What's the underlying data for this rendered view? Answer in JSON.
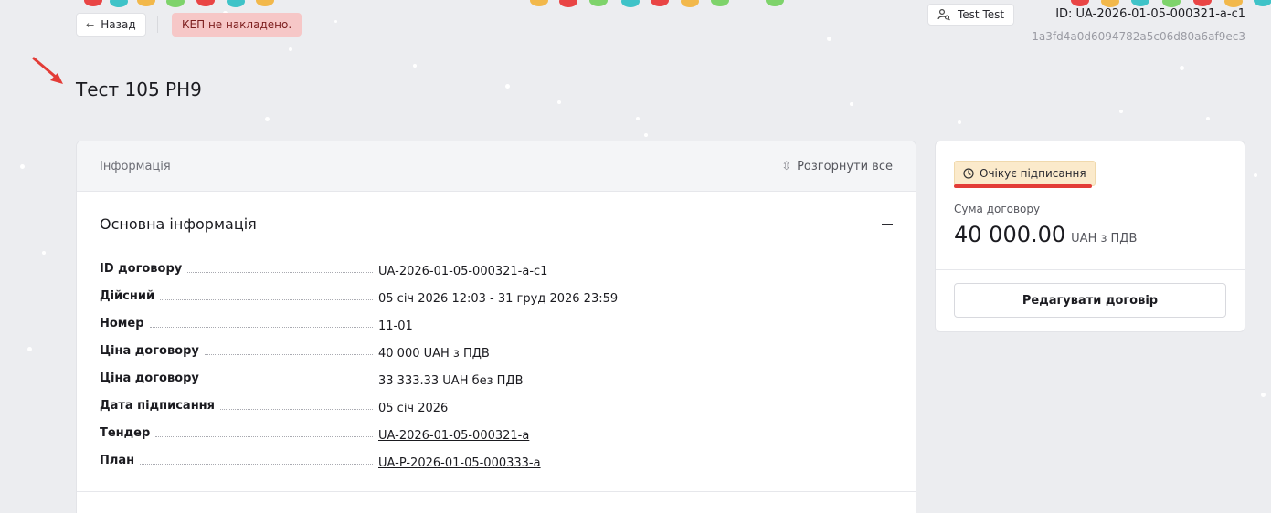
{
  "topbar": {
    "back_label": "Назад",
    "kep_badge": "КЕП не накладено.",
    "user_name": "Test Test",
    "contract_id_header": "ID: UA-2026-01-05-000321-a-c1",
    "hash": "1a3fd4a0d6094782a5c06d80a6af9ec3"
  },
  "page": {
    "title": "Тест 105 РН9"
  },
  "info_card": {
    "header_title": "Інформація",
    "expand_all_label": "Розгорнути все",
    "section_title": "Основна інформація",
    "rows": [
      {
        "label": "ID договору",
        "value": "UA-2026-01-05-000321-a-c1",
        "link": false
      },
      {
        "label": "Дійсний",
        "value": "05 січ 2026 12:03 - 31 груд 2026 23:59",
        "link": false
      },
      {
        "label": "Номер",
        "value": "11-01",
        "link": false
      },
      {
        "label": "Ціна договору",
        "value": "40 000 UAH з ПДВ",
        "link": false
      },
      {
        "label": "Ціна договору",
        "value": "33 333.33 UAH без ПДВ",
        "link": false
      },
      {
        "label": "Дата підписання",
        "value": "05 січ 2026",
        "link": false
      },
      {
        "label": "Тендер",
        "value": "UA-2026-01-05-000321-a",
        "link": true
      },
      {
        "label": "План",
        "value": "UA-P-2026-01-05-000333-a",
        "link": true
      }
    ]
  },
  "side_card": {
    "status": "Очікує підписання",
    "sum_label": "Сума договору",
    "sum_value": "40 000.00",
    "sum_currency": "UAH з ПДВ",
    "edit_button": "Редагувати договір"
  },
  "colors": {
    "background": "#ecedf0",
    "kep_badge_bg": "#f6c7c7",
    "status_badge_bg": "#fbeacb",
    "status_underline": "#e33c37",
    "annotation_arrow": "#e33c37"
  }
}
